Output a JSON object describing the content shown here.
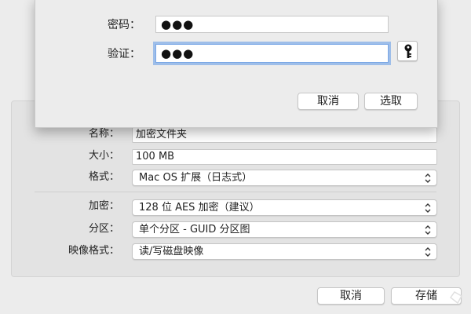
{
  "sheet": {
    "password_label": "密码：",
    "password_value": "●●●",
    "verify_label": "验证：",
    "verify_value": "●●●",
    "key_icon": "key-icon",
    "cancel_label": "取消",
    "choose_label": "选取"
  },
  "form": {
    "name_label": "名称：",
    "name_value": "加密文件夹",
    "size_label": "大小：",
    "size_value": "100 MB",
    "format_label": "格式：",
    "format_value": "Mac OS 扩展（日志式）",
    "encryption_label": "加密：",
    "encryption_value": "128 位 AES 加密（建议）",
    "partition_label": "分区：",
    "partition_value": "单个分区 - GUID 分区图",
    "image_format_label": "映像格式：",
    "image_format_value": "读/写磁盘映像"
  },
  "footer": {
    "cancel_label": "取消",
    "save_label": "存储"
  },
  "colors": {
    "focus_ring": "#5f99e8",
    "background": "#ececec"
  }
}
